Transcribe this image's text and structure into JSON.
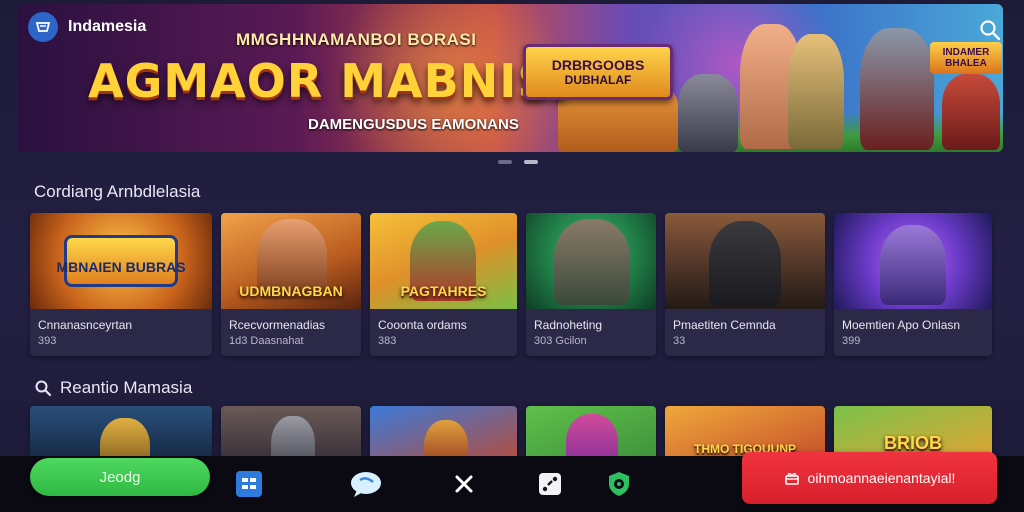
{
  "app": {
    "name": "Indamesia"
  },
  "banner": {
    "subtitle": "MMGHHNAMANBOI BORASI",
    "title": "AGMAOR MABNISI",
    "caption": "DAMENGUSDUS EAMONANS",
    "game_logo_line1": "DRBRGOOBS",
    "game_logo_line2": "DUBHALAF",
    "corner_logo": "INDAMER BHALEA"
  },
  "section1": {
    "title": "Cordiang Arnbdlelasia",
    "cards": [
      {
        "thumb_text": "MBNAIEN BUBRAS",
        "name": "Cnnanasnceyrtan",
        "sub": "393",
        "colors": [
          "#c9641c",
          "#ffb648"
        ]
      },
      {
        "thumb_text": "UDMBNAGBAN",
        "name": "Rcecvormenadias",
        "sub": "1d3 Daasnahat",
        "colors": [
          "#d9782a",
          "#8a3a16"
        ]
      },
      {
        "thumb_text": "PAGTAHRES",
        "name": "Cooonta  ordams",
        "sub": "383",
        "colors": [
          "#f0b030",
          "#7bbf45"
        ]
      },
      {
        "thumb_text": "",
        "name": "Radnoheting",
        "sub": "303 Gcilon",
        "colors": [
          "#2b8a4a",
          "#0e3d25"
        ]
      },
      {
        "thumb_text": "",
        "name": "Pmaetiten Cemnda",
        "sub": "33",
        "colors": [
          "#6a4a36",
          "#2a1e1a"
        ]
      },
      {
        "thumb_text": "",
        "name": "Moemtien Apo Onlasn",
        "sub": "399",
        "colors": [
          "#7a3cc8",
          "#2a1b66"
        ]
      }
    ]
  },
  "section2": {
    "title": "Reantio Mamasia",
    "cards": [
      {
        "colors": [
          "#2a4f7a",
          "#0f1d33"
        ]
      },
      {
        "colors": [
          "#6a5a58",
          "#2c2430"
        ]
      },
      {
        "colors": [
          "#3b7ad8",
          "#c4482a"
        ]
      },
      {
        "colors": [
          "#5fc04a",
          "#7a2c9a"
        ]
      },
      {
        "thumb_text": "THMO TIGOUUNP",
        "colors": [
          "#f0a83a",
          "#c0442a"
        ]
      },
      {
        "thumb_text": "BRIOB",
        "colors": [
          "#7ac24a",
          "#f0a030"
        ]
      }
    ]
  },
  "bottom": {
    "green_button": "Jeodg",
    "red_button": "oihmoannaeienantayial!",
    "icons": [
      "grid-icon",
      "chat-icon",
      "close-icon",
      "dice-icon",
      "shield-icon"
    ]
  }
}
